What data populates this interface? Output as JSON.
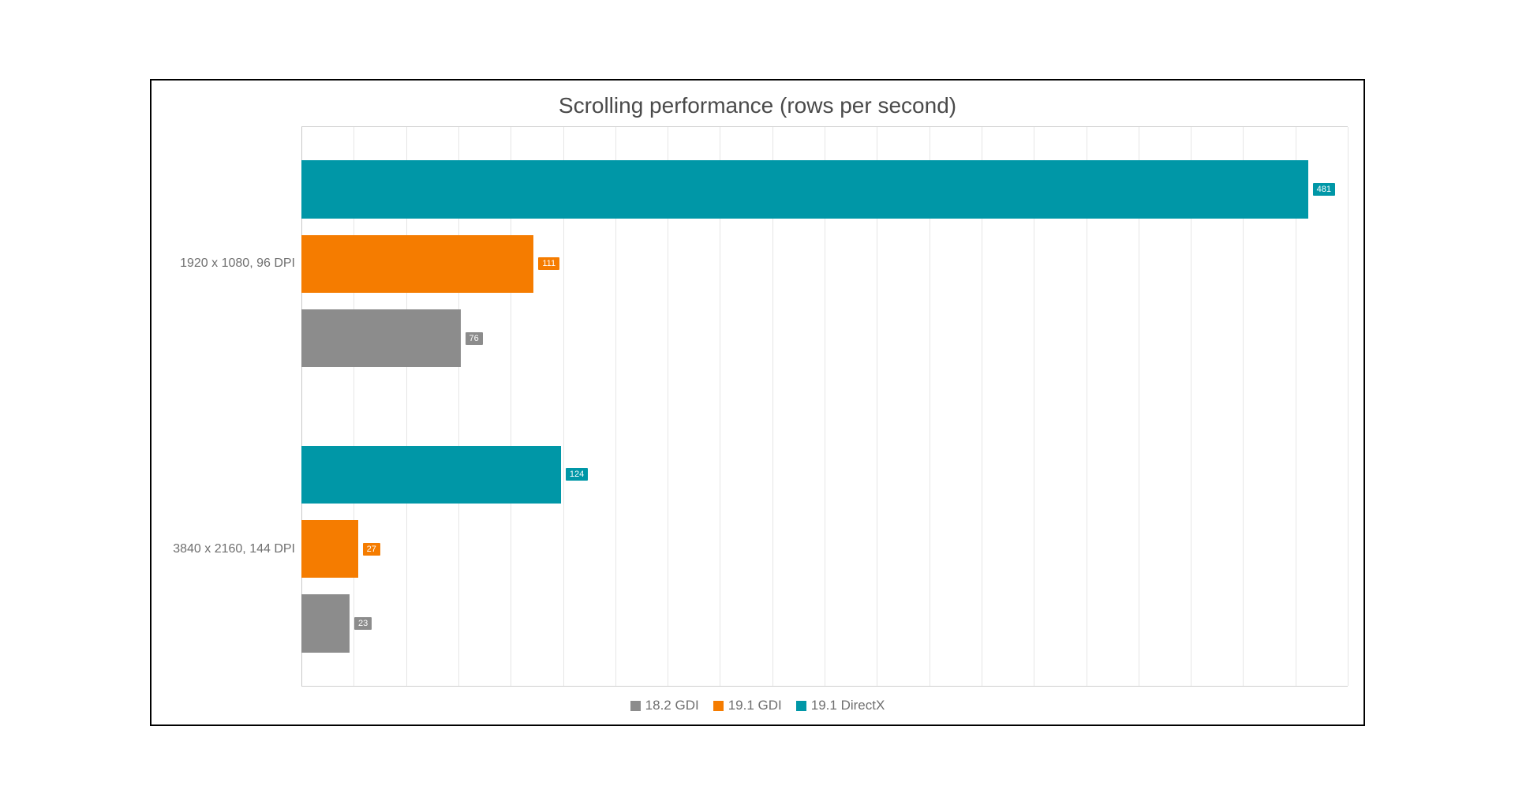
{
  "chart_data": {
    "type": "bar",
    "orientation": "horizontal",
    "title": "Scrolling performance (rows per second)",
    "categories": [
      "1920 x 1080, 96 DPI",
      "3840 x 2160, 144 DPI"
    ],
    "series": [
      {
        "name": "18.2 GDI",
        "color": "#8c8c8c",
        "values": [
          76,
          23
        ]
      },
      {
        "name": "19.1 GDI",
        "color": "#f57c00",
        "values": [
          111,
          27
        ]
      },
      {
        "name": "19.1 DirectX",
        "color": "#0097a7",
        "values": [
          481,
          124
        ]
      }
    ],
    "xlim": [
      0,
      500
    ],
    "x_major_tick": 50,
    "x_minor_tick": 25,
    "xlabel": "",
    "ylabel": ""
  }
}
